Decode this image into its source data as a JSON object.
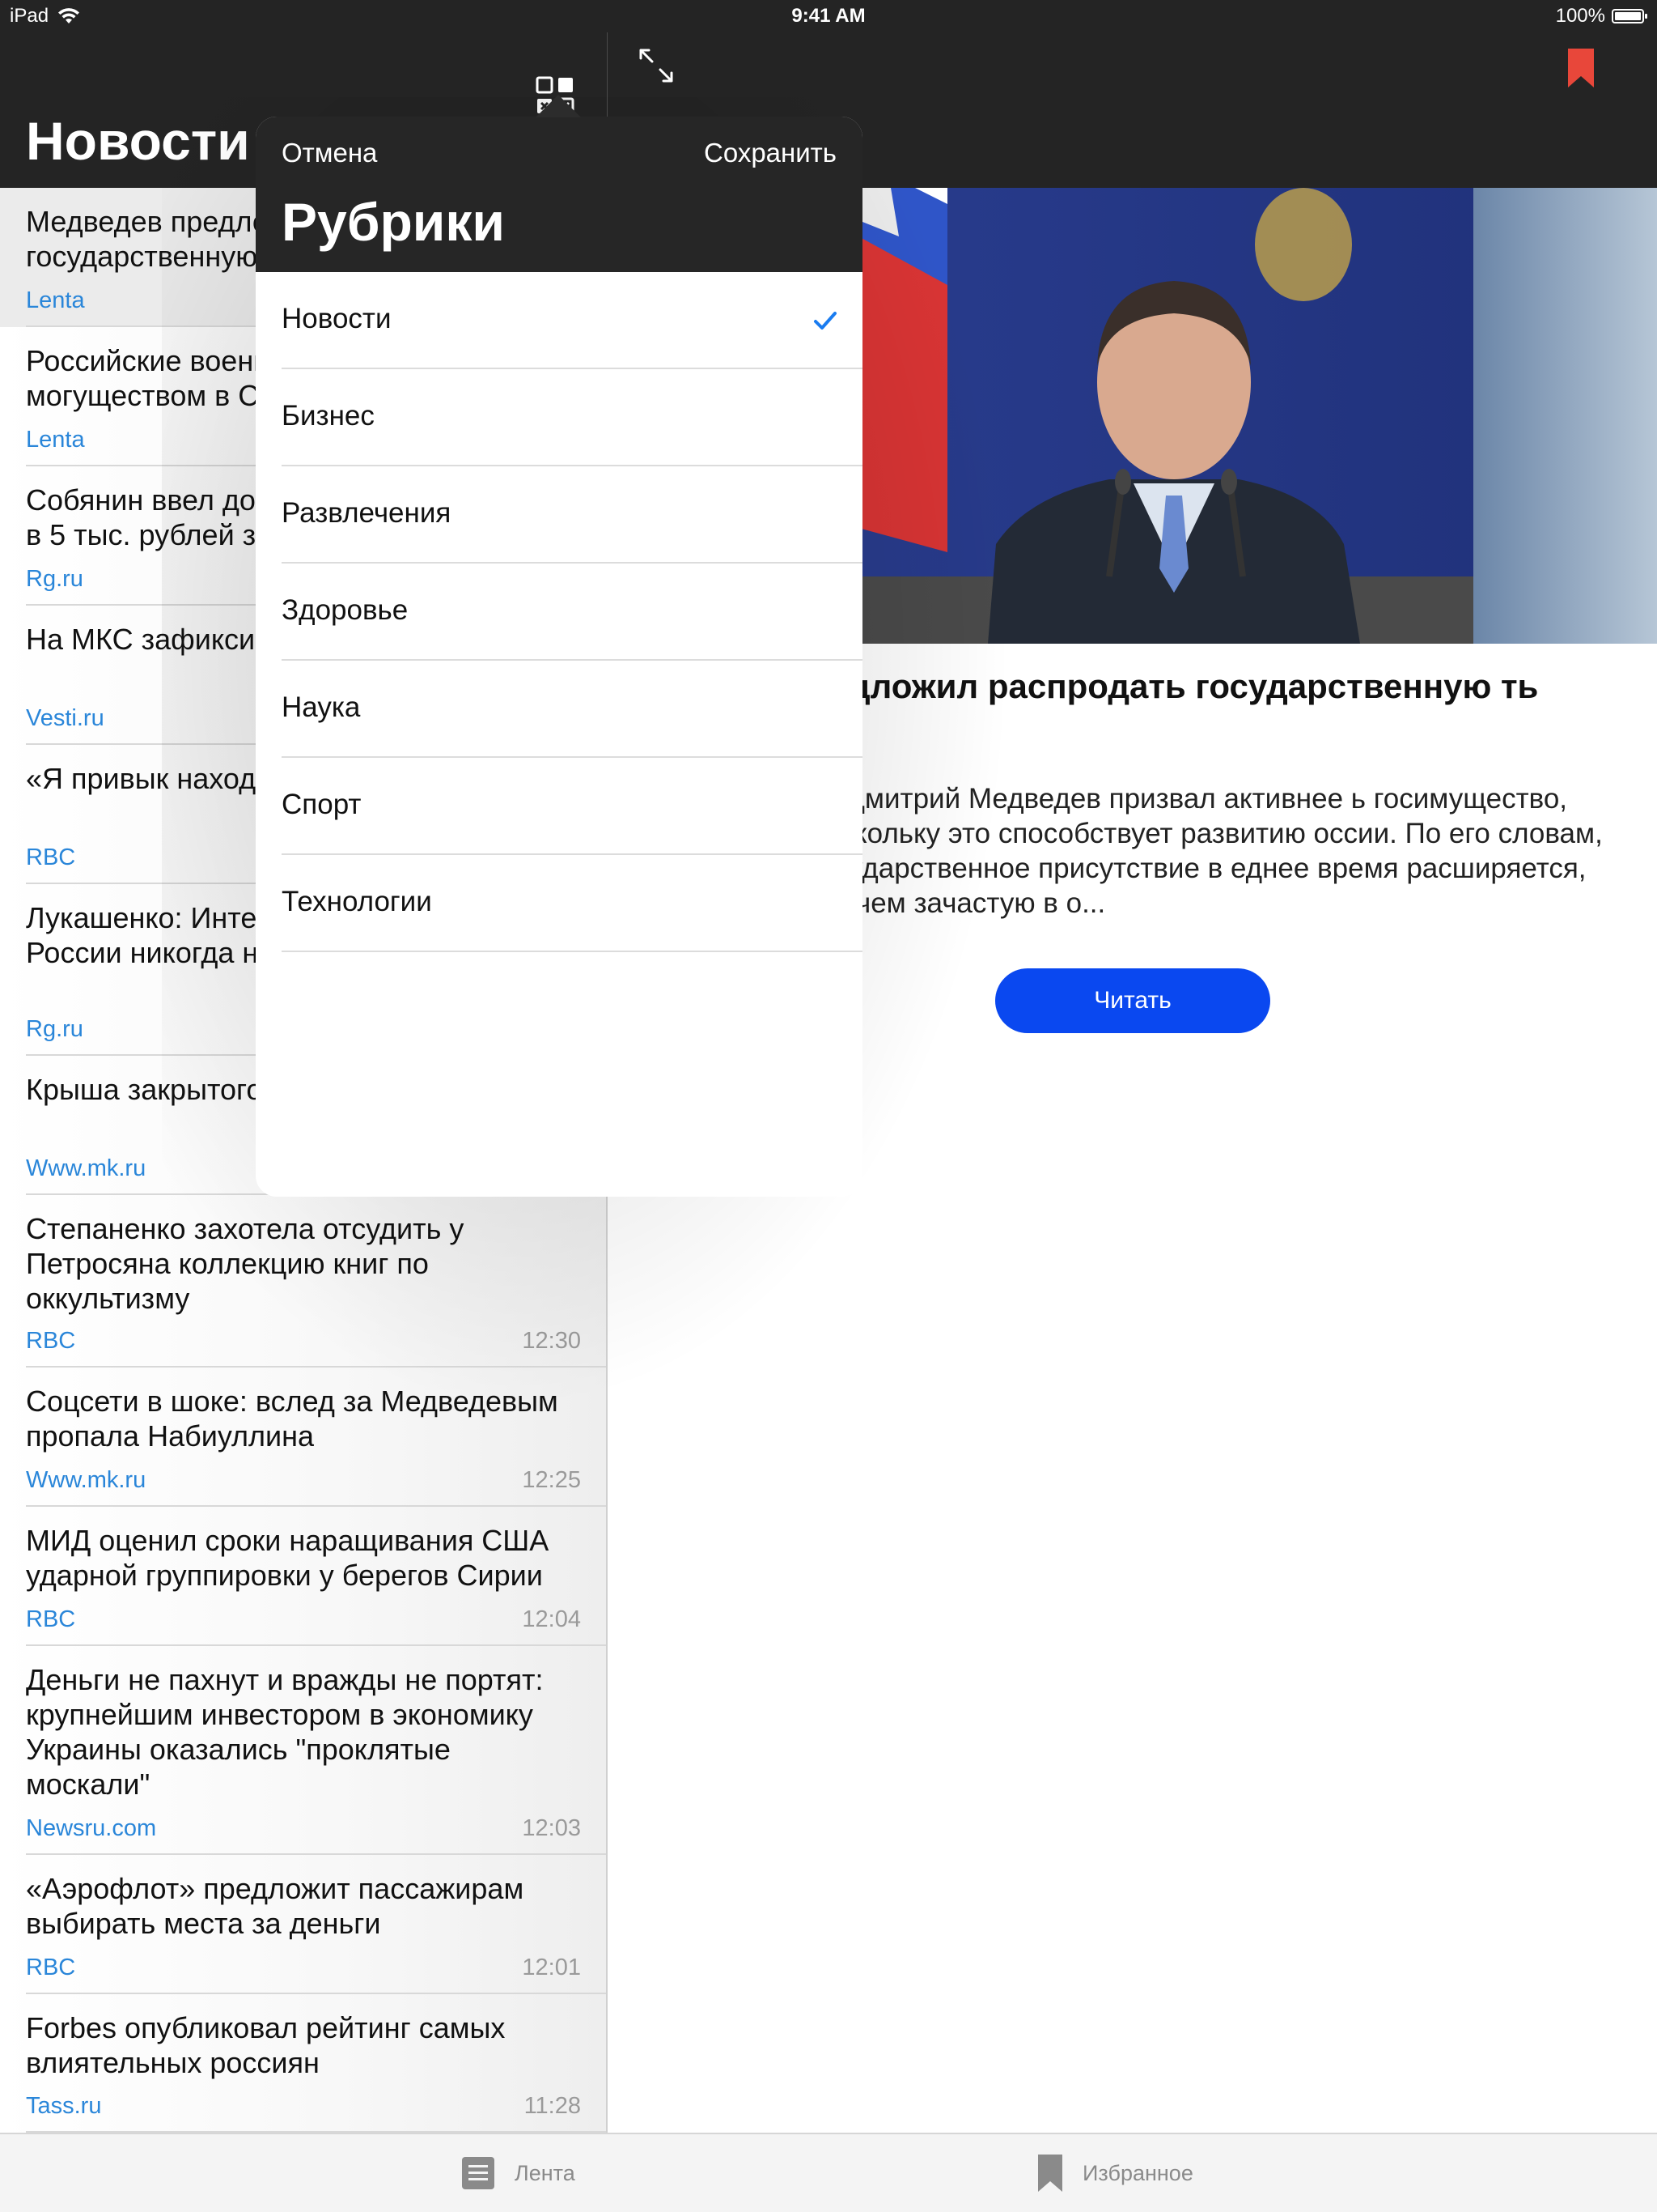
{
  "status_bar": {
    "device": "iPad",
    "time": "9:41 AM",
    "battery": "100%",
    "battery_level": 1.0
  },
  "nav": {
    "title": "Новости"
  },
  "news": [
    {
      "headline": "Медведев предложил распродать государственную",
      "source": "Lenta",
      "time": ""
    },
    {
      "headline": "Российские военные похвастались могуществом в С",
      "source": "Lenta",
      "time": ""
    },
    {
      "headline": "Собянин ввел дополнительные выплаты в 5 тыс. рублей за класс",
      "source": "Rg.ru",
      "time": ""
    },
    {
      "headline": "На МКС зафиксирована утечка воздуха",
      "source": "Vesti.ru",
      "time": ""
    },
    {
      "headline": "«Я привык находить… трудно»: памяти",
      "source": "RBC",
      "time": ""
    },
    {
      "headline": "Лукашенко: Интересы Белоруссии и России никогда не противоречат другу",
      "source": "Rg.ru",
      "time": ""
    },
    {
      "headline": "Крыша закрытого в Реутове рухнула",
      "source": "Www.mk.ru",
      "time": ""
    },
    {
      "headline": "Степаненко захотела отсудить у Петросяна коллекцию книг по оккультизму",
      "source": "RBC",
      "time": "12:30"
    },
    {
      "headline": "Соцсети в шоке: вслед за Медведевым пропала Набиуллина",
      "source": "Www.mk.ru",
      "time": "12:25"
    },
    {
      "headline": "МИД оценил сроки наращивания США ударной группировки у берегов Сирии",
      "source": "RBC",
      "time": "12:04"
    },
    {
      "headline": "Деньги не пахнут и вражды не портят: крупнейшим инвестором в экономику Украины оказались \"проклятые москали\"",
      "source": "Newsru.com",
      "time": "12:03"
    },
    {
      "headline": "«Аэрофлот» предложит пассажирам выбирать места за деньги",
      "source": "RBC",
      "time": "12:01"
    },
    {
      "headline": "Forbes опубликовал рейтинг самых влиятельных россиян",
      "source": "Tass.ru",
      "time": "11:28"
    }
  ],
  "detail": {
    "title": "редложил распродать государственную ть",
    "text": "тр Дмитрий Медведев призвал активнее ь госимущество, поскольку это способствует развитию оссии. По его словам, государственное присутствие в еднее время расширяется, причем зачастую в о...",
    "read_button": "Читать"
  },
  "popover": {
    "cancel": "Отмена",
    "save": "Сохранить",
    "title": "Рубрики",
    "categories": [
      {
        "label": "Новости",
        "checked": true
      },
      {
        "label": "Бизнес",
        "checked": false
      },
      {
        "label": "Развлечения",
        "checked": false
      },
      {
        "label": "Здоровье",
        "checked": false
      },
      {
        "label": "Наука",
        "checked": false
      },
      {
        "label": "Спорт",
        "checked": false
      },
      {
        "label": "Технологии",
        "checked": false
      }
    ]
  },
  "tabbar": {
    "feed": {
      "label": "Лента",
      "icon": "list-icon"
    },
    "favorites": {
      "label": "Избранное",
      "icon": "bookmark-icon"
    }
  },
  "colors": {
    "accent": "#0a48f0",
    "source_link": "#2a86d9",
    "bookmark": "#e8473a",
    "nav_bg": "#242424",
    "check": "#1a7cf0"
  }
}
